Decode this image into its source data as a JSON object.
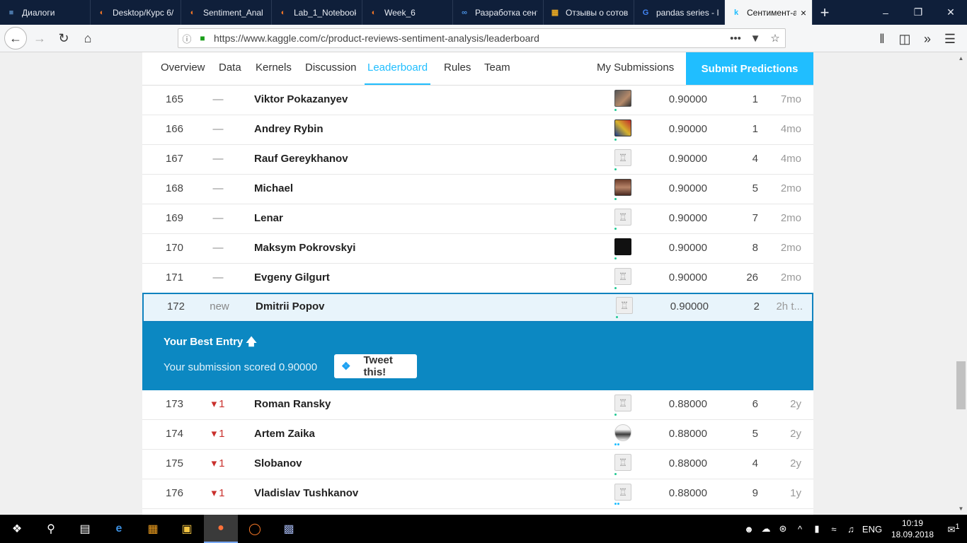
{
  "browser": {
    "tabs": [
      {
        "label": "Диалоги",
        "icon": "chat-icon",
        "color": "#4a76a8"
      },
      {
        "label": "Desktop/Курс 6/",
        "icon": "jupyter-icon",
        "color": "#f37626"
      },
      {
        "label": "Sentiment_Anal",
        "icon": "jupyter-icon",
        "color": "#f37626"
      },
      {
        "label": "Lab_1_Notebook",
        "icon": "jupyter-icon",
        "color": "#f37626"
      },
      {
        "label": "Week_6",
        "icon": "jupyter-icon",
        "color": "#f37626"
      },
      {
        "label": "Разработка сент",
        "icon": "coursera-icon",
        "color": "#4a90e2"
      },
      {
        "label": "Отзывы о сотов",
        "icon": "table-icon",
        "color": "#e5a623"
      },
      {
        "label": "pandas series - I",
        "icon": "google-icon",
        "color": "#4285f4"
      },
      {
        "label": "Сентимент-а",
        "icon": "kaggle-icon",
        "color": "#20beff",
        "active": true
      }
    ],
    "url": "https://www.kaggle.com/c/product-reviews-sentiment-analysis/leaderboard"
  },
  "subnav": {
    "items": [
      "Overview",
      "Data",
      "Kernels",
      "Discussion",
      "Leaderboard",
      "Rules",
      "Team"
    ],
    "active": "Leaderboard",
    "my_submissions": "My Submissions",
    "submit": "Submit Predictions"
  },
  "rows_before": [
    {
      "rank": "165",
      "delta": "—",
      "name": "Viktor Pokazanyev",
      "avatar": "photo",
      "tier": "green",
      "score": "0.90000",
      "entries": "1",
      "last": "7mo"
    },
    {
      "rank": "166",
      "delta": "—",
      "name": "Andrey Rybin",
      "avatar": "colorful",
      "tier": "green",
      "score": "0.90000",
      "entries": "1",
      "last": "4mo"
    },
    {
      "rank": "167",
      "delta": "—",
      "name": "Rauf Gereykhanov",
      "avatar": "default",
      "tier": "green",
      "score": "0.90000",
      "entries": "4",
      "last": "4mo"
    },
    {
      "rank": "168",
      "delta": "—",
      "name": "Michael",
      "avatar": "brown",
      "tier": "green",
      "score": "0.90000",
      "entries": "5",
      "last": "2mo"
    },
    {
      "rank": "169",
      "delta": "—",
      "name": "Lenar",
      "avatar": "default",
      "tier": "green",
      "score": "0.90000",
      "entries": "7",
      "last": "2mo"
    },
    {
      "rank": "170",
      "delta": "—",
      "name": "Maksym Pokrovskyi",
      "avatar": "dark",
      "tier": "green",
      "score": "0.90000",
      "entries": "8",
      "last": "2mo"
    },
    {
      "rank": "171",
      "delta": "—",
      "name": "Evgeny Gilgurt",
      "avatar": "default",
      "tier": "green",
      "score": "0.90000",
      "entries": "26",
      "last": "2mo"
    }
  ],
  "highlight_row": {
    "rank": "172",
    "delta": "new",
    "name": "Dmitrii Popov",
    "avatar": "default",
    "tier": "green",
    "score": "0.90000",
    "entries": "2",
    "last": "2h t..."
  },
  "best_entry": {
    "title": "Your Best Entry",
    "score_text": "Your submission scored 0.90000",
    "tweet": "Tweet this!"
  },
  "rows_after": [
    {
      "rank": "173",
      "delta": "1",
      "name": "Roman Ransky",
      "avatar": "default",
      "tier": "green",
      "score": "0.88000",
      "entries": "6",
      "last": "2y"
    },
    {
      "rank": "174",
      "delta": "1",
      "name": "Artem Zaika",
      "avatar": "person",
      "tier": "blue",
      "score": "0.88000",
      "entries": "5",
      "last": "2y"
    },
    {
      "rank": "175",
      "delta": "1",
      "name": "Slobanov",
      "avatar": "default",
      "tier": "green",
      "score": "0.88000",
      "entries": "4",
      "last": "2y"
    },
    {
      "rank": "176",
      "delta": "1",
      "name": "Vladislav Tushkanov",
      "avatar": "default",
      "tier": "blue",
      "score": "0.88000",
      "entries": "9",
      "last": "1y"
    }
  ],
  "taskbar": {
    "lang": "ENG",
    "time": "10:19",
    "date": "18.09.2018",
    "notifications": "1"
  }
}
